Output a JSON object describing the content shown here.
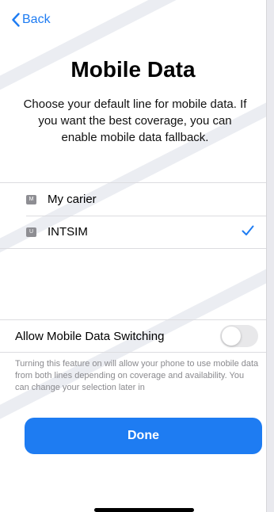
{
  "nav": {
    "back_label": "Back"
  },
  "title": "Mobile Data",
  "description": "Choose your default line for mobile data. If you want the best coverage, you can enable mobile data fallback.",
  "lines": [
    {
      "badge": "M",
      "label": "My carier",
      "selected": false
    },
    {
      "badge": "U",
      "label": "INTSIM",
      "selected": true
    }
  ],
  "switch_row": {
    "label": "Allow Mobile Data Switching",
    "enabled": false
  },
  "footnote": "Turning this feature on will allow your phone to use mobile data from both lines depending on coverage and availability. You can change your selection later in",
  "done_label": "Done",
  "colors": {
    "accent": "#1e7cf2",
    "badge": "#8e8e93",
    "secondary_text": "#8a8a8e"
  }
}
